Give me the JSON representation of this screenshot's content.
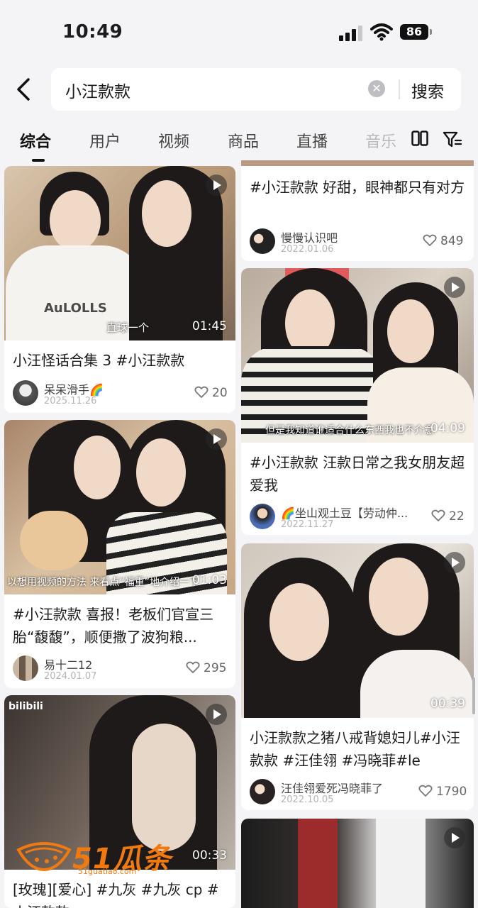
{
  "status": {
    "time": "10:49",
    "battery": "86"
  },
  "search": {
    "query": "小汪款款",
    "button": "搜索"
  },
  "tabs": [
    {
      "label": "综合"
    },
    {
      "label": "用户"
    },
    {
      "label": "视频"
    },
    {
      "label": "商品"
    },
    {
      "label": "直播"
    },
    {
      "label": "音乐"
    }
  ],
  "left_column": [
    {
      "duration": "01:45",
      "overlay": "直球一个",
      "thumb_text": "AuLOLLS",
      "caption": "小汪怪话合集 3 #小汪款款",
      "author": "呆呆滑手🌈",
      "date": "2025.11.26",
      "likes": "20"
    },
    {
      "duration": "01:03",
      "overlay": "以想用视频的方法 来看点“福重”地介绍一下",
      "caption": "#小汪款款 喜报！老板们官宣三胎“馥馥”，顺便撒了波狗粮...",
      "author": "易十二12",
      "date": "2024.01.07",
      "likes": "295"
    },
    {
      "duration": "00:33",
      "thumb_text": "bilibili",
      "caption": "[玫瑰][爱心] #九灰 #九灰 cp # 小汪款款"
    }
  ],
  "right_column": [
    {
      "caption": "#小汪款款 好甜，眼神都只有对方",
      "author": "慢慢认识吧",
      "date": "2022.01.06",
      "likes": "849"
    },
    {
      "duration": "04:09",
      "overlay": "但是我知道谁适合什么东西我也不介意",
      "caption": "#小汪款款 汪款日常之我女朋友超爱我",
      "author": "🌈坐山观土豆【劳动仲...",
      "date": "2022.11.27",
      "likes": "22"
    },
    {
      "duration": "00:39",
      "caption": "小汪款款之猪八戒背媳妇儿#小汪款款 #汪佳翎 #冯晓菲#le",
      "author": "汪佳翎爱死冯晓菲了",
      "date": "2022.10.05",
      "likes": "1790"
    }
  ],
  "watermark": {
    "text": "51瓜条",
    "sub": "51guatiao.com"
  },
  "colors": {
    "accent": "#111111",
    "watermark": "#f07a10",
    "page_bg": "#f4f4f6"
  },
  "icons": [
    "back-arrow-icon",
    "clear-icon",
    "layout-icon",
    "filter-icon",
    "play-icon",
    "heart-icon",
    "signal-icon",
    "wifi-icon",
    "battery-icon"
  ]
}
